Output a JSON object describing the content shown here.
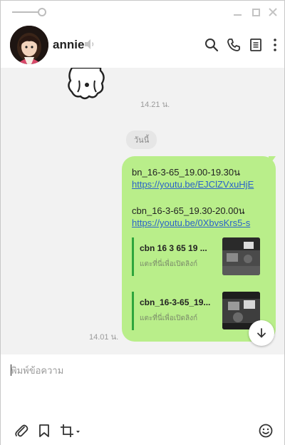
{
  "header": {
    "contact_name": "annie"
  },
  "chat": {
    "sticker_time": "14.21 น.",
    "date_divider": "วันนี้",
    "message": {
      "line1": "bn_16-3-65_19.00-19.30น",
      "link1": "https://youtu.be/EJClZVxuHjE",
      "line2": "cbn_16-3-65_19.30-20.00น",
      "link2": "https://youtu.be/0XbvsKrs5-s",
      "time": "14.01 น."
    },
    "previews": [
      {
        "title": "cbn 16 3 65 19 ...",
        "subtitle": "แตะที่นี่เพื่อเปิดลิงก์"
      },
      {
        "title": "cbn_16-3-65_19...",
        "subtitle": "แตะที่นี่เพื่อเปิดลิงก์"
      }
    ]
  },
  "composer": {
    "placeholder": "พิมพ์ข้อความ"
  },
  "icons": {
    "window": [
      "zoom-slider",
      "minimize-icon",
      "maximize-icon",
      "close-icon"
    ],
    "header": [
      "mute-speaker-icon",
      "search-icon",
      "phone-icon",
      "notes-icon",
      "more-icon"
    ],
    "toolbar": [
      "paperclip-icon",
      "bookmark-icon",
      "crop-icon",
      "emoji-icon"
    ],
    "accent_green": "#b9ee8a",
    "link_blue": "#2a63c9",
    "preview_bar_green": "#2ea63c"
  }
}
